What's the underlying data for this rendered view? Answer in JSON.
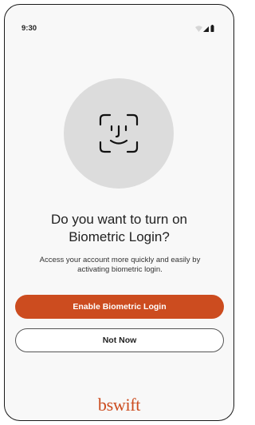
{
  "status_bar": {
    "time": "9:30",
    "icons": [
      "wifi-icon",
      "cellular-icon",
      "battery-icon"
    ]
  },
  "prompt": {
    "headline_line1": "Do you want to turn on",
    "headline_line2": "Biometric Login?",
    "description_line1": "Access your account more quickly and easily by",
    "description_line2": "activating biometric login.",
    "icon": "face-id-icon"
  },
  "actions": {
    "enable_label": "Enable Biometric Login",
    "not_now_label": "Not Now"
  },
  "brand": {
    "logo_text": "bswift"
  },
  "colors": {
    "accent": "#cc4c1f",
    "background": "#f8f8f8",
    "icon_circle": "#dcdcdc"
  }
}
